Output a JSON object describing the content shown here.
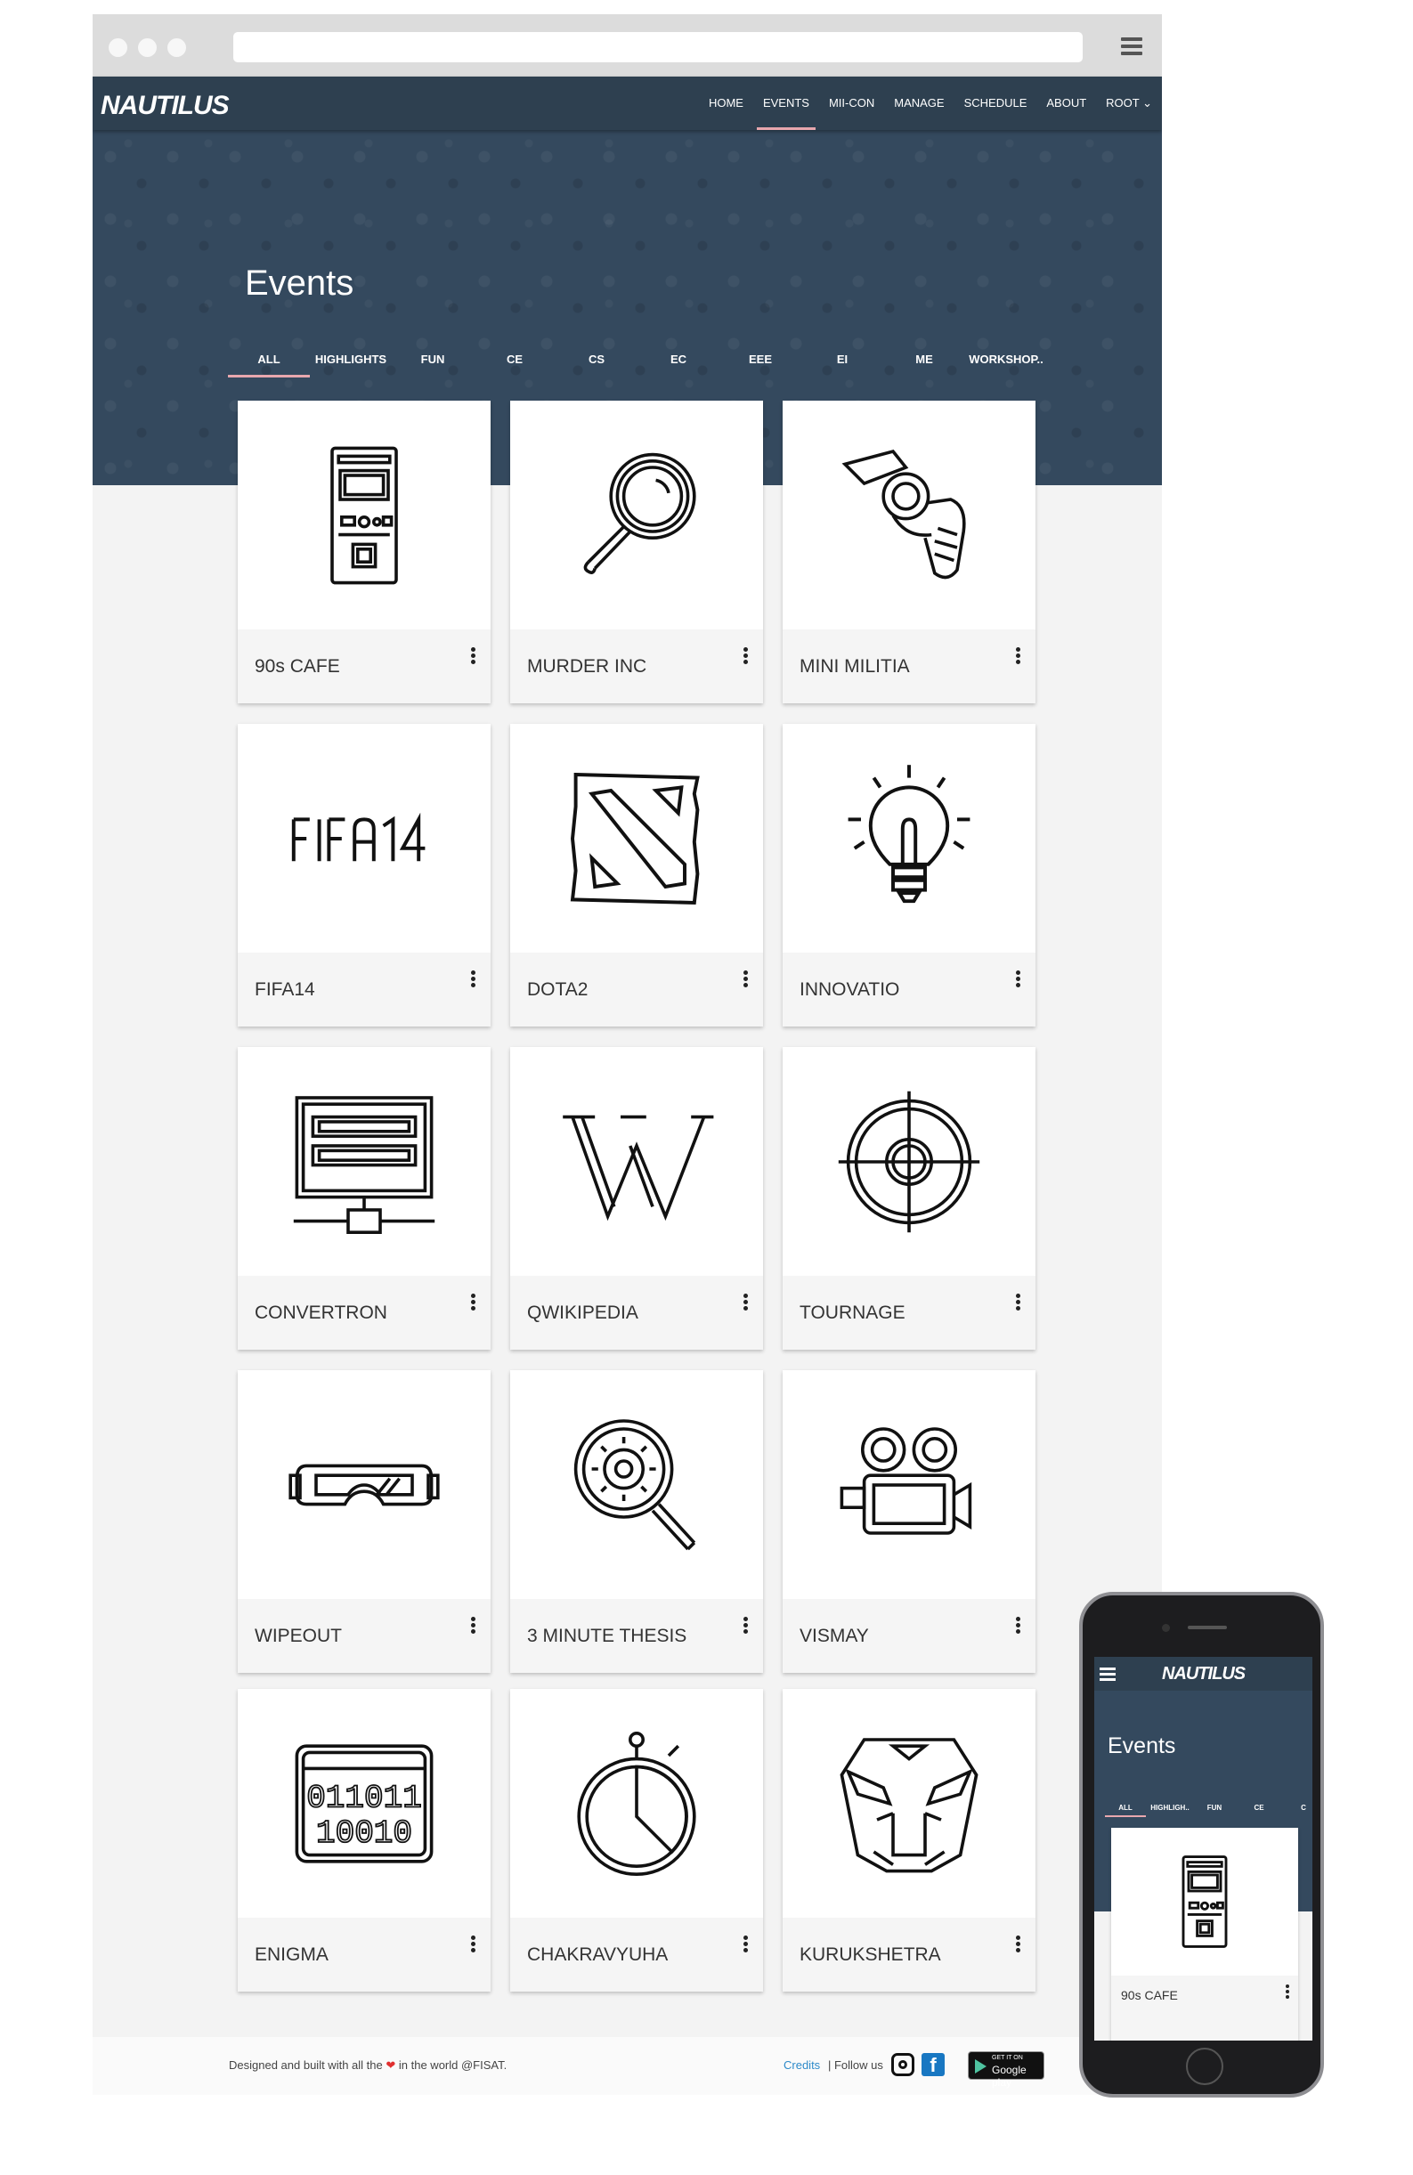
{
  "site": {
    "logo": "NAUTILUS",
    "nav": [
      "HOME",
      "EVENTS",
      "MII-CON",
      "MANAGE",
      "SCHEDULE",
      "ABOUT",
      "ROOT ⌄"
    ],
    "active_nav": "EVENTS"
  },
  "page": {
    "title": "Events",
    "tabs": [
      "ALL",
      "HIGHLIGHTS",
      "FUN",
      "CE",
      "CS",
      "EC",
      "EEE",
      "EI",
      "ME",
      "WORKSHOP.."
    ],
    "active_tab": "ALL"
  },
  "events": [
    {
      "title": "90s CAFE",
      "icon": "arcade-machine-icon"
    },
    {
      "title": "MURDER INC",
      "icon": "magnifying-glass-icon"
    },
    {
      "title": "MINI MILITIA",
      "icon": "revolver-icon"
    },
    {
      "title": "FIFA14",
      "icon": "fifa14-logo-icon"
    },
    {
      "title": "DOTA2",
      "icon": "dota2-logo-icon"
    },
    {
      "title": "INNOVATIO",
      "icon": "lightbulb-icon"
    },
    {
      "title": "CONVERTRON",
      "icon": "server-icon"
    },
    {
      "title": "QWIKIPEDIA",
      "icon": "wikipedia-icon"
    },
    {
      "title": "TOURNAGE",
      "icon": "crosshair-icon"
    },
    {
      "title": "WIPEOUT",
      "icon": "vr-goggles-icon"
    },
    {
      "title": "3 MINUTE THESIS",
      "icon": "gear-search-icon"
    },
    {
      "title": "VISMAY",
      "icon": "film-camera-icon"
    },
    {
      "title": "ENIGMA",
      "icon": "binary-code-icon"
    },
    {
      "title": "CHAKRAVYUHA",
      "icon": "stopwatch-icon"
    },
    {
      "title": "KURUKSHETRA",
      "icon": "autobot-icon"
    }
  ],
  "footer": {
    "prefix": "Designed and built with all the",
    "suffix": "in the world @FISAT.",
    "credits": "Credits",
    "follow": "| Follow us",
    "gplay_small": "GET IT ON",
    "gplay_big": "Google play"
  },
  "mobile": {
    "logo": "NAUTILUS",
    "title": "Events",
    "tabs": [
      "ALL",
      "HIGHLIGH..",
      "FUN",
      "CE",
      "C"
    ],
    "card_title": "90s CAFE"
  }
}
